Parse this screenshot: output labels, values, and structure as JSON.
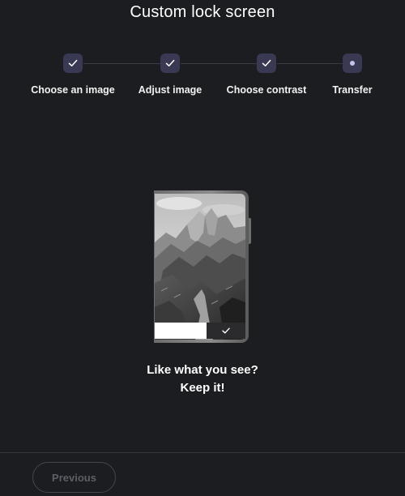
{
  "page": {
    "title": "Custom lock screen"
  },
  "stepper": {
    "steps": [
      {
        "label": "Choose an image",
        "state": "complete",
        "icon": "check-icon"
      },
      {
        "label": "Adjust image",
        "state": "complete",
        "icon": "check-icon"
      },
      {
        "label": "Choose contrast",
        "state": "complete",
        "icon": "check-icon"
      },
      {
        "label": "Transfer",
        "state": "current",
        "icon": "dot-icon"
      }
    ]
  },
  "preview": {
    "image": "grayscale mountain landscape",
    "confirm_icon": "check-icon"
  },
  "prompt": {
    "line1": "Like what you see?",
    "line2": "Keep it!"
  },
  "footer": {
    "previous_label": "Previous"
  },
  "colors": {
    "background": "#1c1d20",
    "step_badge": "#3a3954",
    "step_dot": "#c7c3ee",
    "text": "#ffffff",
    "disabled_text": "#5d5e66"
  }
}
